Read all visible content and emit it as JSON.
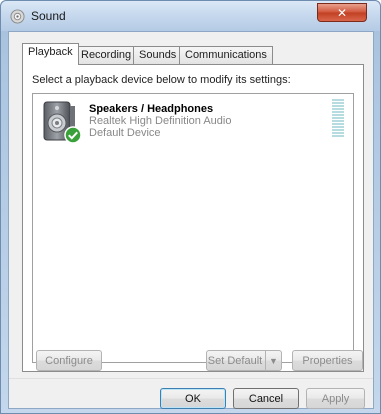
{
  "window": {
    "title": "Sound",
    "close_glyph": "✕"
  },
  "tabs": [
    {
      "label": "Playback",
      "active": true
    },
    {
      "label": "Recording",
      "active": false
    },
    {
      "label": "Sounds",
      "active": false
    },
    {
      "label": "Communications",
      "active": false
    }
  ],
  "playback": {
    "instruction": "Select a playback device below to modify its settings:",
    "devices": [
      {
        "name": "Speakers / Headphones",
        "description": "Realtek High Definition Audio",
        "status": "Default Device",
        "icon": "speaker-icon",
        "badge_icon": "default-device-check-icon",
        "level": 0
      }
    ],
    "buttons": {
      "configure": "Configure",
      "set_default": "Set Default",
      "properties": "Properties"
    }
  },
  "dialog_buttons": {
    "ok": "OK",
    "cancel": "Cancel",
    "apply": "Apply"
  },
  "colors": {
    "check_badge": "#3aa13a",
    "meter": "#b6dbe1",
    "title_bar": "#c3d6ec"
  }
}
